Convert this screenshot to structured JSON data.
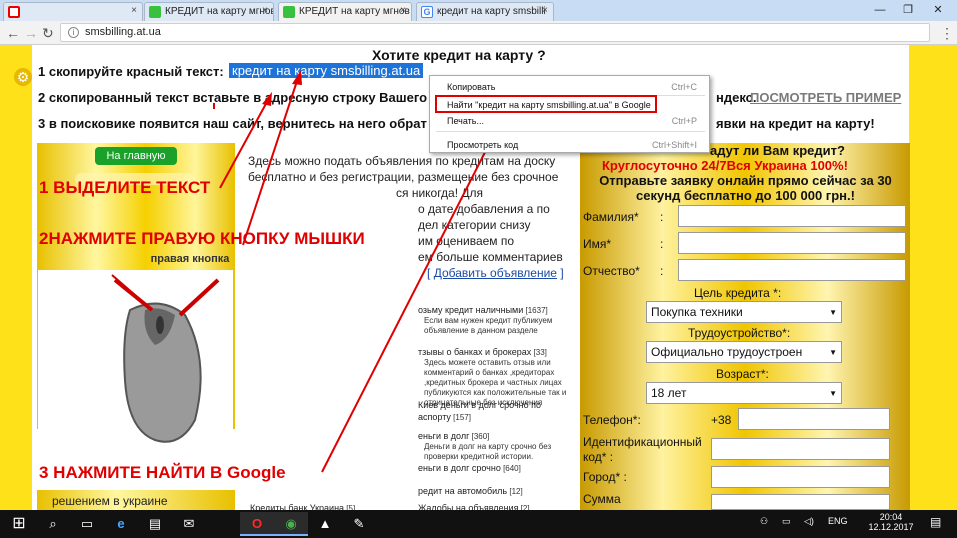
{
  "browser": {
    "tabs": [
      {
        "label": "",
        "close": "×"
      },
      {
        "label": "КРЕДИТ на карту мгнов",
        "close": "×"
      },
      {
        "label": "КРЕДИТ на карту мгнов",
        "close": "×"
      },
      {
        "label": "кредит на карту smsbilli",
        "close": "×"
      }
    ],
    "window_controls": {
      "minimize": "—",
      "restore": "❐",
      "close": "✕"
    },
    "url": "smsbilling.at.ua",
    "nav": {
      "back": "←",
      "forward": "→",
      "reload": "↻",
      "menu": "⋮"
    }
  },
  "page": {
    "heading": "Хотите кредит на карту ?",
    "step1_label": "1 скопируйте красный текст:",
    "step1_highlight": "кредит на карту smsbilling.at.ua",
    "step2_prefix": "2 скопированный текст вставьте в адресную строку Вашего",
    "step2_suffix": "ндекс.",
    "step2_link": "ПОСМОТРЕТЬ ПРИМЕР",
    "step3_prefix": "3 в поисковике появится наш сайт, вернитесь на него обрат",
    "step3_suffix": "явки на кредит на карту!",
    "home_button": "На главную",
    "instr1": "1 ВЫДЕЛИТЕ ТЕКСТ",
    "instr2": "2НАЖМИТЕ ПРАВУЮ КНОПКУ МЫШКИ",
    "mouse_caption": "правая кнопка",
    "instr3": "3 НАЖМИТЕ НАЙТИ В Google",
    "left_bottom": "решением в украине",
    "mid_lines": [
      "Здесь можно подать объявления по кредитам на доску",
      "бесплатно и без регистрации, размещение без срочное",
      "ся никогда! Для",
      "о дате добавления а по",
      "дел категории снизу",
      "им оцениваем по",
      "ем больше комментариев"
    ],
    "add_ad_prefix": "[",
    "add_ad_link": "Добавить объявление",
    "add_ad_suffix": "]",
    "categories": [
      {
        "title": "озьму кредит наличными",
        "count": "[1637]",
        "desc": "Если вам нужен кредит публикуем объявление в данном разделе"
      },
      {
        "title": "тзывы о банках и брокерах",
        "count": "[33]",
        "desc": "Здесь можете оставить отзыв или комментарий о банках ,кредиторах ,кредитных брокера и частных лицах публикуются как положительные так и отрицательные без исключения"
      },
      {
        "title": "Киев деньги в долг срочно по",
        "count": "",
        "desc": ""
      },
      {
        "title": "аспорту",
        "count": "[157]",
        "desc": ""
      },
      {
        "title": "еньги в долг",
        "count": "[360]",
        "desc": "Деньги в долг на карту срочно без проверки кредитной истории."
      },
      {
        "title": "еньги в долг срочно",
        "count": "[640]",
        "desc": ""
      },
      {
        "title": "редит на автомобиль",
        "count": "[12]",
        "desc": ""
      },
      {
        "title": "Кредиты банк Украина",
        "count": "[5]",
        "desc": ""
      },
      {
        "title": "Жалобы на объявления",
        "count": "[2]",
        "desc": ""
      }
    ],
    "form": {
      "header_partial": "адут ли Вам кредит?",
      "banner_red": "Круглосуточно 24/7Вся Украина 100%!",
      "banner_black": "Отправьте заявку онлайн прямо сейчас за 30 секунд бесплатно до 100 000 грн.!",
      "fields": [
        {
          "label": "Фамилия*",
          "colon": ":"
        },
        {
          "label": "Имя*",
          "colon": ":"
        },
        {
          "label": "Отчество*",
          "colon": ":"
        }
      ],
      "purpose_label": "Цель  кредита *:",
      "purpose_value": "Покупка техники",
      "employment_label": "Трудоустройство*:",
      "employment_value": "Официально трудоустроен",
      "age_label": "Возраст*:",
      "age_value": "18 лет",
      "phone_label": "Телефон*:",
      "phone_prefix": "+38",
      "inn_label": "Идентификационный код* :",
      "city_label": "Город* :",
      "sum_label": "Сумма"
    }
  },
  "context_menu": {
    "items": [
      {
        "label": "Копировать",
        "shortcut": "Ctrl+C"
      },
      {
        "label": "Найти \"кредит на карту smsbilling.at.ua\" в Google",
        "shortcut": ""
      },
      {
        "label": "Печать...",
        "shortcut": "Ctrl+P"
      },
      {
        "label": "Просмотреть код",
        "shortcut": "Ctrl+Shift+I"
      }
    ]
  },
  "taskbar": {
    "start": "⊞",
    "apps": [
      "⌕",
      "▭",
      "e",
      "▤",
      "✉",
      "O",
      "◉",
      "▲",
      "✎"
    ],
    "tray": {
      "lang": "ENG",
      "time": "20:04",
      "date": "12.12.2017"
    }
  },
  "colors": {
    "accent_red": "#e00000",
    "page_yellow": "#ffe11a",
    "selection_blue": "#1e73d8"
  }
}
